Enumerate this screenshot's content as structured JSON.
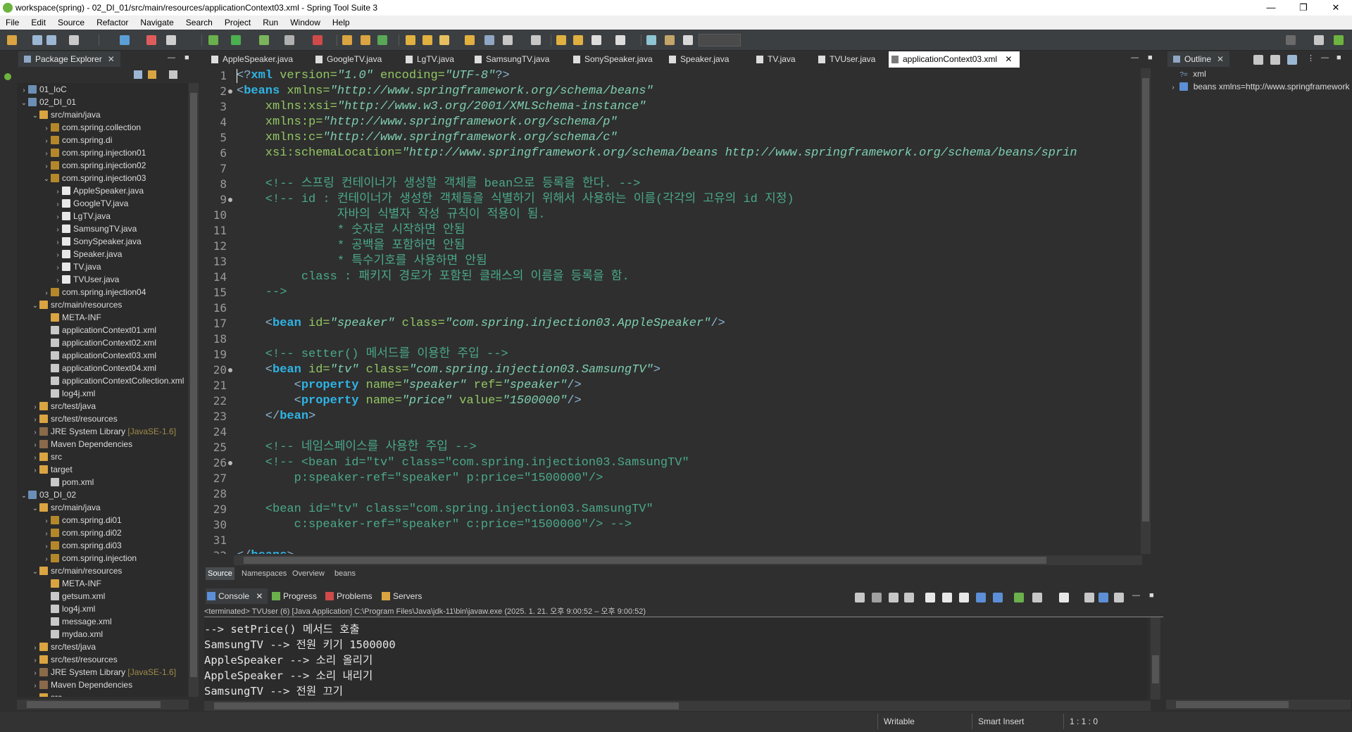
{
  "window": {
    "title": "workspace(spring) - 02_DI_01/src/main/resources/applicationContext03.xml - Spring Tool Suite 3",
    "minimize": "—",
    "restore": "❐",
    "close": "✕"
  },
  "menu": [
    "File",
    "Edit",
    "Source",
    "Refactor",
    "Navigate",
    "Search",
    "Project",
    "Run",
    "Window",
    "Help"
  ],
  "package_explorer": {
    "title": "Package Explorer",
    "close": "✕",
    "rows": [
      {
        "indent": 0,
        "arrow": "›",
        "icon": "proj",
        "label": "01_IoC"
      },
      {
        "indent": 0,
        "arrow": "⌄",
        "icon": "proj",
        "label": "02_DI_01"
      },
      {
        "indent": 1,
        "arrow": "⌄",
        "icon": "folder",
        "label": "src/main/java"
      },
      {
        "indent": 2,
        "arrow": "›",
        "icon": "pkg",
        "label": "com.spring.collection"
      },
      {
        "indent": 2,
        "arrow": "›",
        "icon": "pkg",
        "label": "com.spring.di"
      },
      {
        "indent": 2,
        "arrow": "›",
        "icon": "pkg",
        "label": "com.spring.injection01"
      },
      {
        "indent": 2,
        "arrow": "›",
        "icon": "pkg",
        "label": "com.spring.injection02"
      },
      {
        "indent": 2,
        "arrow": "⌄",
        "icon": "pkg",
        "label": "com.spring.injection03"
      },
      {
        "indent": 3,
        "arrow": "›",
        "icon": "java",
        "label": "AppleSpeaker.java"
      },
      {
        "indent": 3,
        "arrow": "›",
        "icon": "java",
        "label": "GoogleTV.java"
      },
      {
        "indent": 3,
        "arrow": "›",
        "icon": "java",
        "label": "LgTV.java"
      },
      {
        "indent": 3,
        "arrow": "›",
        "icon": "java",
        "label": "SamsungTV.java"
      },
      {
        "indent": 3,
        "arrow": "›",
        "icon": "java",
        "label": "SonySpeaker.java"
      },
      {
        "indent": 3,
        "arrow": "›",
        "icon": "java",
        "label": "Speaker.java"
      },
      {
        "indent": 3,
        "arrow": "›",
        "icon": "java",
        "label": "TV.java"
      },
      {
        "indent": 3,
        "arrow": "›",
        "icon": "java",
        "label": "TVUser.java"
      },
      {
        "indent": 2,
        "arrow": "›",
        "icon": "pkg",
        "label": "com.spring.injection04"
      },
      {
        "indent": 1,
        "arrow": "⌄",
        "icon": "folder",
        "label": "src/main/resources"
      },
      {
        "indent": 2,
        "arrow": "",
        "icon": "folder",
        "label": "META-INF"
      },
      {
        "indent": 2,
        "arrow": "",
        "icon": "xml",
        "label": "applicationContext01.xml"
      },
      {
        "indent": 2,
        "arrow": "",
        "icon": "xml",
        "label": "applicationContext02.xml"
      },
      {
        "indent": 2,
        "arrow": "",
        "icon": "xml",
        "label": "applicationContext03.xml"
      },
      {
        "indent": 2,
        "arrow": "",
        "icon": "xml",
        "label": "applicationContext04.xml"
      },
      {
        "indent": 2,
        "arrow": "",
        "icon": "xml",
        "label": "applicationContextCollection.xml"
      },
      {
        "indent": 2,
        "arrow": "",
        "icon": "xml",
        "label": "log4j.xml"
      },
      {
        "indent": 1,
        "arrow": "›",
        "icon": "folder",
        "label": "src/test/java"
      },
      {
        "indent": 1,
        "arrow": "›",
        "icon": "folder",
        "label": "src/test/resources"
      },
      {
        "indent": 1,
        "arrow": "›",
        "icon": "lib",
        "label": "JRE System Library",
        "deco": "[JavaSE-1.6]"
      },
      {
        "indent": 1,
        "arrow": "›",
        "icon": "lib",
        "label": "Maven Dependencies"
      },
      {
        "indent": 1,
        "arrow": "›",
        "icon": "folder",
        "label": "src"
      },
      {
        "indent": 1,
        "arrow": "›",
        "icon": "folder",
        "label": "target"
      },
      {
        "indent": 2,
        "arrow": "",
        "icon": "xml",
        "label": "pom.xml"
      },
      {
        "indent": 0,
        "arrow": "⌄",
        "icon": "proj",
        "label": "03_DI_02"
      },
      {
        "indent": 1,
        "arrow": "⌄",
        "icon": "folder",
        "label": "src/main/java"
      },
      {
        "indent": 2,
        "arrow": "›",
        "icon": "pkg",
        "label": "com.spring.di01"
      },
      {
        "indent": 2,
        "arrow": "›",
        "icon": "pkg",
        "label": "com.spring.di02"
      },
      {
        "indent": 2,
        "arrow": "›",
        "icon": "pkg",
        "label": "com.spring.di03"
      },
      {
        "indent": 2,
        "arrow": "›",
        "icon": "pkg",
        "label": "com.spring.injection"
      },
      {
        "indent": 1,
        "arrow": "⌄",
        "icon": "folder",
        "label": "src/main/resources"
      },
      {
        "indent": 2,
        "arrow": "",
        "icon": "folder",
        "label": "META-INF"
      },
      {
        "indent": 2,
        "arrow": "",
        "icon": "xml",
        "label": "getsum.xml"
      },
      {
        "indent": 2,
        "arrow": "",
        "icon": "xml",
        "label": "log4j.xml"
      },
      {
        "indent": 2,
        "arrow": "",
        "icon": "xml",
        "label": "message.xml"
      },
      {
        "indent": 2,
        "arrow": "",
        "icon": "xml",
        "label": "mydao.xml"
      },
      {
        "indent": 1,
        "arrow": "›",
        "icon": "folder",
        "label": "src/test/java"
      },
      {
        "indent": 1,
        "arrow": "›",
        "icon": "folder",
        "label": "src/test/resources"
      },
      {
        "indent": 1,
        "arrow": "›",
        "icon": "lib",
        "label": "JRE System Library",
        "deco": "[JavaSE-1.6]"
      },
      {
        "indent": 1,
        "arrow": "›",
        "icon": "lib",
        "label": "Maven Dependencies"
      },
      {
        "indent": 1,
        "arrow": "›",
        "icon": "folder",
        "label": "src"
      }
    ]
  },
  "editor_tabs": [
    {
      "label": "AppleSpeaker.java",
      "active": false
    },
    {
      "label": "GoogleTV.java",
      "active": false
    },
    {
      "label": "LgTV.java",
      "active": false
    },
    {
      "label": "SamsungTV.java",
      "active": false
    },
    {
      "label": "SonySpeaker.java",
      "active": false
    },
    {
      "label": "Speaker.java",
      "active": false
    },
    {
      "label": "TV.java",
      "active": false
    },
    {
      "label": "TVUser.java",
      "active": false
    },
    {
      "label": "applicationContext03.xml",
      "active": true
    }
  ],
  "code": [
    [
      [
        "pun",
        "<?"
      ],
      [
        "kw",
        "xml"
      ],
      [
        "att",
        " version="
      ],
      [
        "val",
        "\"1.0\""
      ],
      [
        "att",
        " encoding="
      ],
      [
        "val",
        "\"UTF-8\""
      ],
      [
        "pun",
        "?>"
      ]
    ],
    [
      [
        "pun",
        "<"
      ],
      [
        "kw",
        "beans"
      ],
      [
        "att",
        " xmlns="
      ],
      [
        "val",
        "\"http://www.springframework.org/schema/beans\""
      ]
    ],
    [
      [
        "att",
        "    xmlns:xsi="
      ],
      [
        "val",
        "\"http://www.w3.org/2001/XMLSchema-instance\""
      ]
    ],
    [
      [
        "att",
        "    xmlns:p="
      ],
      [
        "val",
        "\"http://www.springframework.org/schema/p\""
      ]
    ],
    [
      [
        "att",
        "    xmlns:c="
      ],
      [
        "val",
        "\"http://www.springframework.org/schema/c\""
      ]
    ],
    [
      [
        "att",
        "    xsi:schemaLocation="
      ],
      [
        "val",
        "\"http://www.springframework.org/schema/beans http://www.springframework.org/schema/beans/sprin"
      ]
    ],
    [],
    [
      [
        "cmt",
        "    <!-- 스프링 컨테이너가 생성할 객체를 bean으로 등록을 한다. -->"
      ]
    ],
    [
      [
        "cmt",
        "    <!-- id : 컨테이너가 생성한 객체들을 식별하기 위해서 사용하는 이름(각각의 고유의 id 지정)"
      ]
    ],
    [
      [
        "cmt",
        "              자바의 식별자 작성 규칙이 적용이 됨."
      ]
    ],
    [
      [
        "cmt",
        "              * 숫자로 시작하면 안됨"
      ]
    ],
    [
      [
        "cmt",
        "              * 공백을 포함하면 안됨"
      ]
    ],
    [
      [
        "cmt",
        "              * 특수기호를 사용하면 안됨"
      ]
    ],
    [
      [
        "cmt",
        "         class : 패키지 경로가 포함된 클래스의 이름을 등록을 함."
      ]
    ],
    [
      [
        "cmt",
        "    -->"
      ]
    ],
    [],
    [
      [
        "pun",
        "    <"
      ],
      [
        "kw",
        "bean"
      ],
      [
        "att",
        " id="
      ],
      [
        "val",
        "\"speaker\""
      ],
      [
        "att",
        " class="
      ],
      [
        "val",
        "\"com.spring.injection03.AppleSpeaker\""
      ],
      [
        "pun",
        "/>"
      ]
    ],
    [],
    [
      [
        "cmt",
        "    <!-- setter() 메서드를 이용한 주입 -->"
      ]
    ],
    [
      [
        "pun",
        "    <"
      ],
      [
        "kw",
        "bean"
      ],
      [
        "att",
        " id="
      ],
      [
        "val",
        "\"tv\""
      ],
      [
        "att",
        " class="
      ],
      [
        "val",
        "\"com.spring.injection03.SamsungTV\""
      ],
      [
        "pun",
        ">"
      ]
    ],
    [
      [
        "pun",
        "        <"
      ],
      [
        "kw",
        "property"
      ],
      [
        "att",
        " name="
      ],
      [
        "val",
        "\"speaker\""
      ],
      [
        "att",
        " ref="
      ],
      [
        "val",
        "\"speaker\""
      ],
      [
        "pun",
        "/>"
      ]
    ],
    [
      [
        "pun",
        "        <"
      ],
      [
        "kw",
        "property"
      ],
      [
        "att",
        " name="
      ],
      [
        "val",
        "\"price\""
      ],
      [
        "att",
        " value="
      ],
      [
        "val",
        "\"1500000\""
      ],
      [
        "pun",
        "/>"
      ]
    ],
    [
      [
        "pun",
        "    </"
      ],
      [
        "kw",
        "bean"
      ],
      [
        "pun",
        ">"
      ]
    ],
    [],
    [
      [
        "cmt",
        "    <!-- 네임스페이스를 사용한 주입 -->"
      ]
    ],
    [
      [
        "cmt",
        "    <!-- <bean id=\"tv\" class=\"com.spring.injection03.SamsungTV\""
      ]
    ],
    [
      [
        "cmt",
        "        p:speaker-ref=\"speaker\" p:price=\"1500000\"/>"
      ]
    ],
    [],
    [
      [
        "cmt",
        "    <bean id=\"tv\" class=\"com.spring.injection03.SamsungTV\""
      ]
    ],
    [
      [
        "cmt",
        "        c:speaker-ref=\"speaker\" c:price=\"1500000\"/> -->"
      ]
    ],
    [],
    [
      [
        "pun",
        "</"
      ],
      [
        "kw",
        "beans"
      ],
      [
        "pun",
        ">"
      ]
    ]
  ],
  "fold_lines": [
    2,
    9,
    20,
    26
  ],
  "source_tabs": [
    {
      "label": "Source",
      "active": true
    },
    {
      "label": "Namespaces",
      "active": false
    },
    {
      "label": "Overview",
      "active": false
    },
    {
      "label": "beans",
      "active": false
    }
  ],
  "console_tabs": [
    {
      "label": "Console",
      "active": true,
      "close": "✕"
    },
    {
      "label": "Progress",
      "active": false
    },
    {
      "label": "Problems",
      "active": false
    },
    {
      "label": "Servers",
      "active": false
    }
  ],
  "console": {
    "header": "<terminated> TVUser (6) [Java Application] C:\\Program Files\\Java\\jdk-11\\bin\\javaw.exe  (2025. 1. 21. 오후 9:00:52 – 오후 9:00:52)",
    "lines": [
      "--> setPrice() 메서드 호출",
      "SamsungTV --> 전원 키기 1500000",
      "AppleSpeaker --> 소리 올리기",
      "AppleSpeaker --> 소리 내리기",
      "SamsungTV --> 전원 끄기"
    ]
  },
  "outline": {
    "title": "Outline",
    "close": "✕",
    "items": [
      {
        "label": "xml",
        "arrow": ""
      },
      {
        "label": "beans xmlns=http://www.springframework",
        "arrow": "›"
      }
    ]
  },
  "status": {
    "writable": "Writable",
    "insert_mode": "Smart Insert",
    "position": "1 : 1 : 0"
  },
  "colors": {
    "accent": "#6db33f",
    "tag": "#2fb4e6",
    "attribute": "#93c763",
    "value": "#7ecfb0",
    "comment": "#4aa88a"
  }
}
